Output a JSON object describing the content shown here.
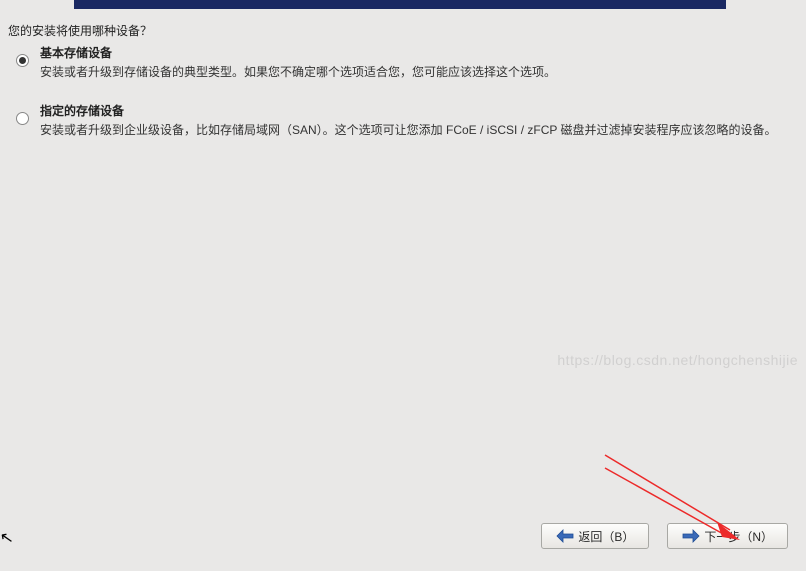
{
  "prompt": "您的安装将使用哪种设备？",
  "options": [
    {
      "title": "基本存储设备",
      "desc": "安装或者升级到存储设备的典型类型。如果您不确定哪个选项适合您，您可能应该选择这个选项。",
      "selected": true
    },
    {
      "title": "指定的存储设备",
      "desc": "安装或者升级到企业级设备，比如存储局域网（SAN）。这个选项可让您添加 FCoE / iSCSI / zFCP 磁盘并过滤掉安装程序应该忽略的设备。",
      "selected": false
    }
  ],
  "buttons": {
    "back": "返回（B）",
    "next": "下一步（N）"
  },
  "watermark": "https://blog.csdn.net/hongchenshijie"
}
